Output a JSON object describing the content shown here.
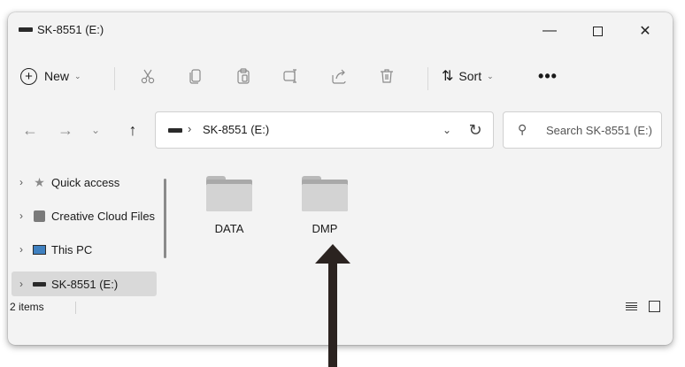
{
  "window": {
    "title": "SK-8551 (E:)",
    "controls": {
      "minimize": "—",
      "maximize": "",
      "close": "✕"
    }
  },
  "toolbar": {
    "new_label": "New",
    "sort_label": "Sort",
    "more_label": "•••",
    "icons": [
      "cut-icon",
      "copy-icon",
      "paste-icon",
      "rename-icon",
      "share-icon",
      "delete-icon"
    ]
  },
  "navigation": {
    "back": "←",
    "forward": "→",
    "recent": "⌄",
    "up": "↑"
  },
  "address_bar": {
    "separator": "›",
    "path": "SK-8551 (E:)",
    "dropdown": "⌄",
    "refresh": "↻"
  },
  "search": {
    "placeholder": "Search SK-8551 (E:)"
  },
  "sidebar": {
    "items": [
      {
        "label": "Quick access",
        "icon": "star-icon",
        "selected": false
      },
      {
        "label": "Creative Cloud Files",
        "icon": "creative-cloud-icon",
        "selected": false
      },
      {
        "label": "This PC",
        "icon": "computer-icon",
        "selected": false
      },
      {
        "label": "SK-8551 (E:)",
        "icon": "drive-icon",
        "selected": true
      }
    ]
  },
  "content": {
    "folders": [
      {
        "name": "DATA"
      },
      {
        "name": "DMP"
      }
    ]
  },
  "status": {
    "item_count": "2 items"
  },
  "annotation": {
    "arrow_target": "DMP",
    "arrow_color": "#2b2320"
  }
}
